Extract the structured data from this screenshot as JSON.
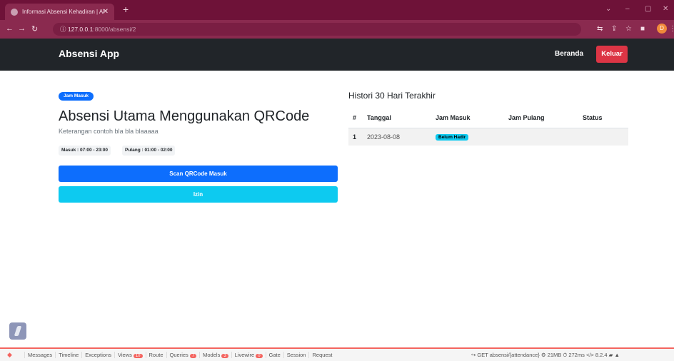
{
  "browser": {
    "tab_title": "Informasi Absensi Kehadiran | Al",
    "url_host": "127.0.0.1",
    "url_path": ":8000/absensi/2",
    "profile_initial": "D"
  },
  "app": {
    "brand": "Absensi App",
    "nav_beranda": "Beranda",
    "nav_keluar": "Keluar"
  },
  "main": {
    "badge": "Jam Masuk",
    "title": "Absensi Utama Menggunakan QRCode",
    "description": "Keterangan contoh bla bla blaaaaa",
    "masuk": "Masuk : 07:00 - 23:00",
    "pulang": "Pulang : 01:00 - 02:00",
    "scan_button": "Scan QRCode Masuk",
    "izin_button": "Izin"
  },
  "history": {
    "heading": "Histori 30 Hari Terakhir",
    "columns": [
      "#",
      "Tanggal",
      "Jam Masuk",
      "Jam Pulang",
      "Status"
    ],
    "rows": [
      {
        "no": "1",
        "tanggal": "2023-08-08",
        "jam_masuk_badge": "Belum Hadir",
        "jam_pulang": "",
        "status": ""
      }
    ]
  },
  "debugbar": {
    "items": [
      {
        "label": "Messages"
      },
      {
        "label": "Timeline"
      },
      {
        "label": "Exceptions"
      },
      {
        "label": "Views",
        "count": "10"
      },
      {
        "label": "Route"
      },
      {
        "label": "Queries",
        "count": "7"
      },
      {
        "label": "Models",
        "count": "3"
      },
      {
        "label": "Livewire",
        "count": "0"
      },
      {
        "label": "Gate"
      },
      {
        "label": "Session"
      },
      {
        "label": "Request"
      }
    ],
    "request": "GET absensi/{attendance}",
    "memory": "21MB",
    "time": "272ms",
    "php": "8.2.4"
  },
  "colors": {
    "primary": "#0d6efd",
    "info": "#0dcaf0",
    "danger": "#dc3545",
    "navbar": "#212529",
    "browser": "#8a2a4f"
  }
}
